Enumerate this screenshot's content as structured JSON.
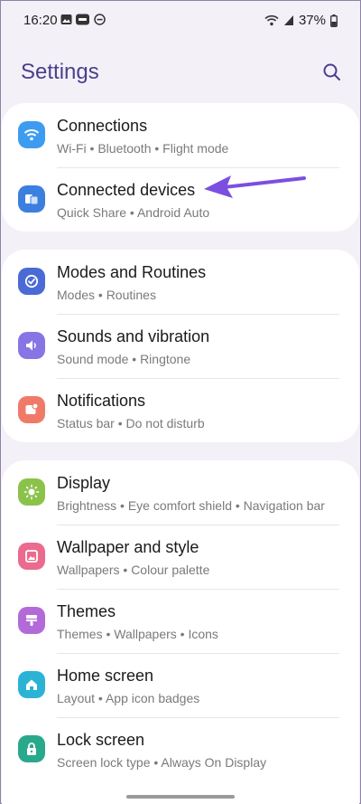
{
  "status_bar": {
    "time": "16:20",
    "battery": "37%",
    "notification_icons": [
      "image-icon",
      "pay-icon",
      "do-not-disturb-icon"
    ],
    "system_icons": [
      "wifi-icon",
      "signal-icon",
      "battery-icon"
    ]
  },
  "header": {
    "title": "Settings",
    "search_icon": "search-icon"
  },
  "groups": [
    {
      "items": [
        {
          "name": "Connections",
          "sub": "Wi-Fi  •  Bluetooth  •  Flight mode",
          "icon": "wifi-icon",
          "color": "#3d9cf0"
        },
        {
          "name": "Connected devices",
          "sub": "Quick Share  •  Android Auto",
          "icon": "devices-icon",
          "color": "#3b7fdf"
        }
      ]
    },
    {
      "items": [
        {
          "name": "Modes and Routines",
          "sub": "Modes  •  Routines",
          "icon": "check-circle-icon",
          "color": "#4a6ad6"
        },
        {
          "name": "Sounds and vibration",
          "sub": "Sound mode  •  Ringtone",
          "icon": "speaker-icon",
          "color": "#8775e6"
        },
        {
          "name": "Notifications",
          "sub": "Status bar  •  Do not disturb",
          "icon": "notification-icon",
          "color": "#f07a6a"
        }
      ]
    },
    {
      "items": [
        {
          "name": "Display",
          "sub": "Brightness  •  Eye comfort shield  •  Navigation bar",
          "icon": "brightness-icon",
          "color": "#8bc34a"
        },
        {
          "name": "Wallpaper and style",
          "sub": "Wallpapers  •  Colour palette",
          "icon": "wallpaper-icon",
          "color": "#ea6b8e"
        },
        {
          "name": "Themes",
          "sub": "Themes  •  Wallpapers  •  Icons",
          "icon": "themes-icon",
          "color": "#b36ad9"
        },
        {
          "name": "Home screen",
          "sub": "Layout  •  App icon badges",
          "icon": "home-icon",
          "color": "#2bb3d6"
        },
        {
          "name": "Lock screen",
          "sub": "Screen lock type  •  Always On Display",
          "icon": "lock-icon",
          "color": "#29a98b"
        }
      ]
    }
  ],
  "annotation": {
    "arrow_color": "#7b4fe0"
  }
}
